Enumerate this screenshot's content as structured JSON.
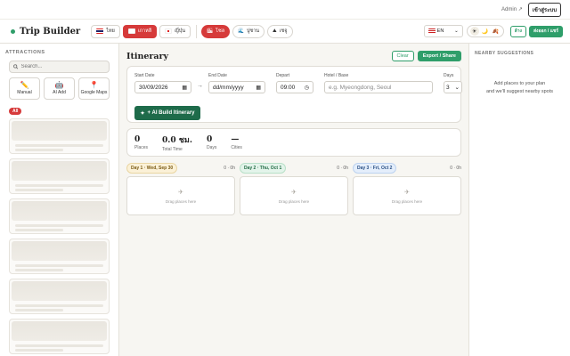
{
  "topbar": {
    "admin_label": "Admin ↗",
    "login_label": "เข้าสู่ระบบ"
  },
  "header": {
    "title": "Trip Builder",
    "country_tabs": [
      {
        "label": "ไทย",
        "flag": "th"
      },
      {
        "label": "เกาหลี",
        "flag": "kr",
        "active": true
      },
      {
        "label": "ญี่ปุ่น",
        "flag": "jp"
      }
    ],
    "mode_tabs": [
      {
        "label": "โซล",
        "icon": "city-icon",
        "active": true
      },
      {
        "label": "ปูซาน",
        "icon": "beach-icon"
      },
      {
        "label": "เชจู",
        "icon": "mountain-icon"
      }
    ],
    "language": {
      "value": "EN",
      "flag": "us"
    },
    "theme_icons": [
      "sun-icon",
      "moon-icon",
      "leaf-icon"
    ],
    "secondary_button": "ล้าง",
    "primary_button": "ส่งออก / แชร์"
  },
  "sidebar": {
    "section_title": "ATTRACTIONS",
    "search_placeholder": "Search...",
    "add_buttons": [
      {
        "label": "Manual",
        "icon": "pencil-icon"
      },
      {
        "label": "AI Add",
        "icon": "robot-icon"
      },
      {
        "label": "Google Maps",
        "icon": "map-pin-icon"
      }
    ],
    "category": "All"
  },
  "main": {
    "title": "Itinerary",
    "clear_label": "Clear",
    "export_label": "Export / Share",
    "form": {
      "start_label": "Start Date",
      "start_value": "30/09/2026",
      "end_label": "End Date",
      "end_value": "dd/mm/yyyy",
      "depart_label": "Depart",
      "depart_value": "09:00",
      "hotel_label": "Hotel / Base",
      "hotel_placeholder": "e.g. Myeongdong, Seoul",
      "days_label": "Days",
      "days_value": "3",
      "arrow": "→"
    },
    "ai_button": "+ AI Build Itinerary",
    "stats": [
      {
        "value": "0",
        "label": "Places"
      },
      {
        "value": "0.0 ชม.",
        "label": "Total Time"
      },
      {
        "value": "0",
        "label": "Days"
      },
      {
        "value": "—",
        "label": "Cities"
      }
    ],
    "days": [
      {
        "title": "Day 1 · Wed, Sep 30",
        "count": "0 · 0h",
        "drop_text": "Drag places here"
      },
      {
        "title": "Day 2 · Thu, Oct 1",
        "count": "0 · 0h",
        "drop_text": "Drag places here"
      },
      {
        "title": "Day 3 · Fri, Oct 2",
        "count": "0 · 0h",
        "drop_text": "Drag places here"
      }
    ]
  },
  "nearby": {
    "title": "NEARBY SUGGESTIONS",
    "line1": "Add places to your plan",
    "line2": "and we'll suggest nearby spots"
  },
  "colors": {
    "accent_green": "#2f9e6a",
    "dark_green": "#1e6b4a",
    "accent_red": "#d63a3a"
  }
}
